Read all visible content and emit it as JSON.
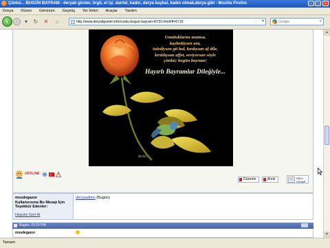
{
  "window": {
    "title": "Çünkü... BUGÜN BAYRAM - deryalı günler, örgü, el işi, dantel, kadın, derya baykal, kadın olmak,derya gibi - Mozilla Firefox"
  },
  "menu": [
    "Dosya",
    "Düzen",
    "Görünüm",
    "Geçmiş",
    "Yer İmleri",
    "Araçlar",
    "Yardım"
  ],
  "nav": {
    "url": "http://www.deryaligunler.info/cunku-bugun-bayram-t6733.html#ft=6733",
    "search_placeholder": "Google"
  },
  "post": {
    "poem_lines": [
      "Unuttuklarını anımsa,",
      "kaybettiysen ara,",
      "özlediysen git bul, kırdıysan af dile,",
      "kırıldıysan affet, seviyorsan söyle",
      "çünkü; bugün bayram!"
    ],
    "poem_title": "Hayırlı Bayramlar Dileğiyle...",
    "signature": "Beth0...",
    "status_label": "OFFLINE",
    "buttons": {
      "edit": "Düzenle",
      "quote": "Alıntı",
      "quick_reply": "HIZLI CEVAP"
    }
  },
  "thanks": {
    "username": "mssdegazor",
    "label": "Kullanıcısına Bu Mesajı İçin Teşekkür Edenler:",
    "show_all": "Hepsini Geri Al",
    "thanker_name": "deryaadmin",
    "thanker_time": "(Bugün)"
  },
  "next_post": {
    "time": "Bugün, 03:15 PM",
    "author": "mssdegazor"
  },
  "statusbar": {
    "text": "Tamam"
  }
}
